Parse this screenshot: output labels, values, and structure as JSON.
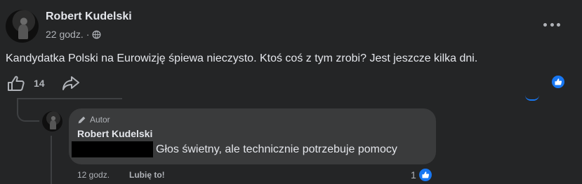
{
  "post": {
    "author": "Robert Kudelski",
    "time": "22 godz.",
    "separator": "·",
    "text": "Kandydatka Polski na Eurowizję śpiewa nieczysto. Ktoś coś z tym zrobi? Jest jeszcze kilka dni.",
    "like_count": "14",
    "menu_icon": "more-icon",
    "privacy_icon": "globe-icon"
  },
  "comment": {
    "badge": "Autor",
    "author": "Robert Kudelski",
    "text": "Głos świetny, ale technicznie potrzebuje pomocy",
    "time": "12 godz.",
    "like_action": "Lubię to!",
    "reaction_count": "1"
  },
  "colors": {
    "background": "#242526",
    "bubble": "#3a3b3c",
    "accent": "#1877f2",
    "text": "#e4e6eb",
    "muted": "#b0b3b8"
  }
}
